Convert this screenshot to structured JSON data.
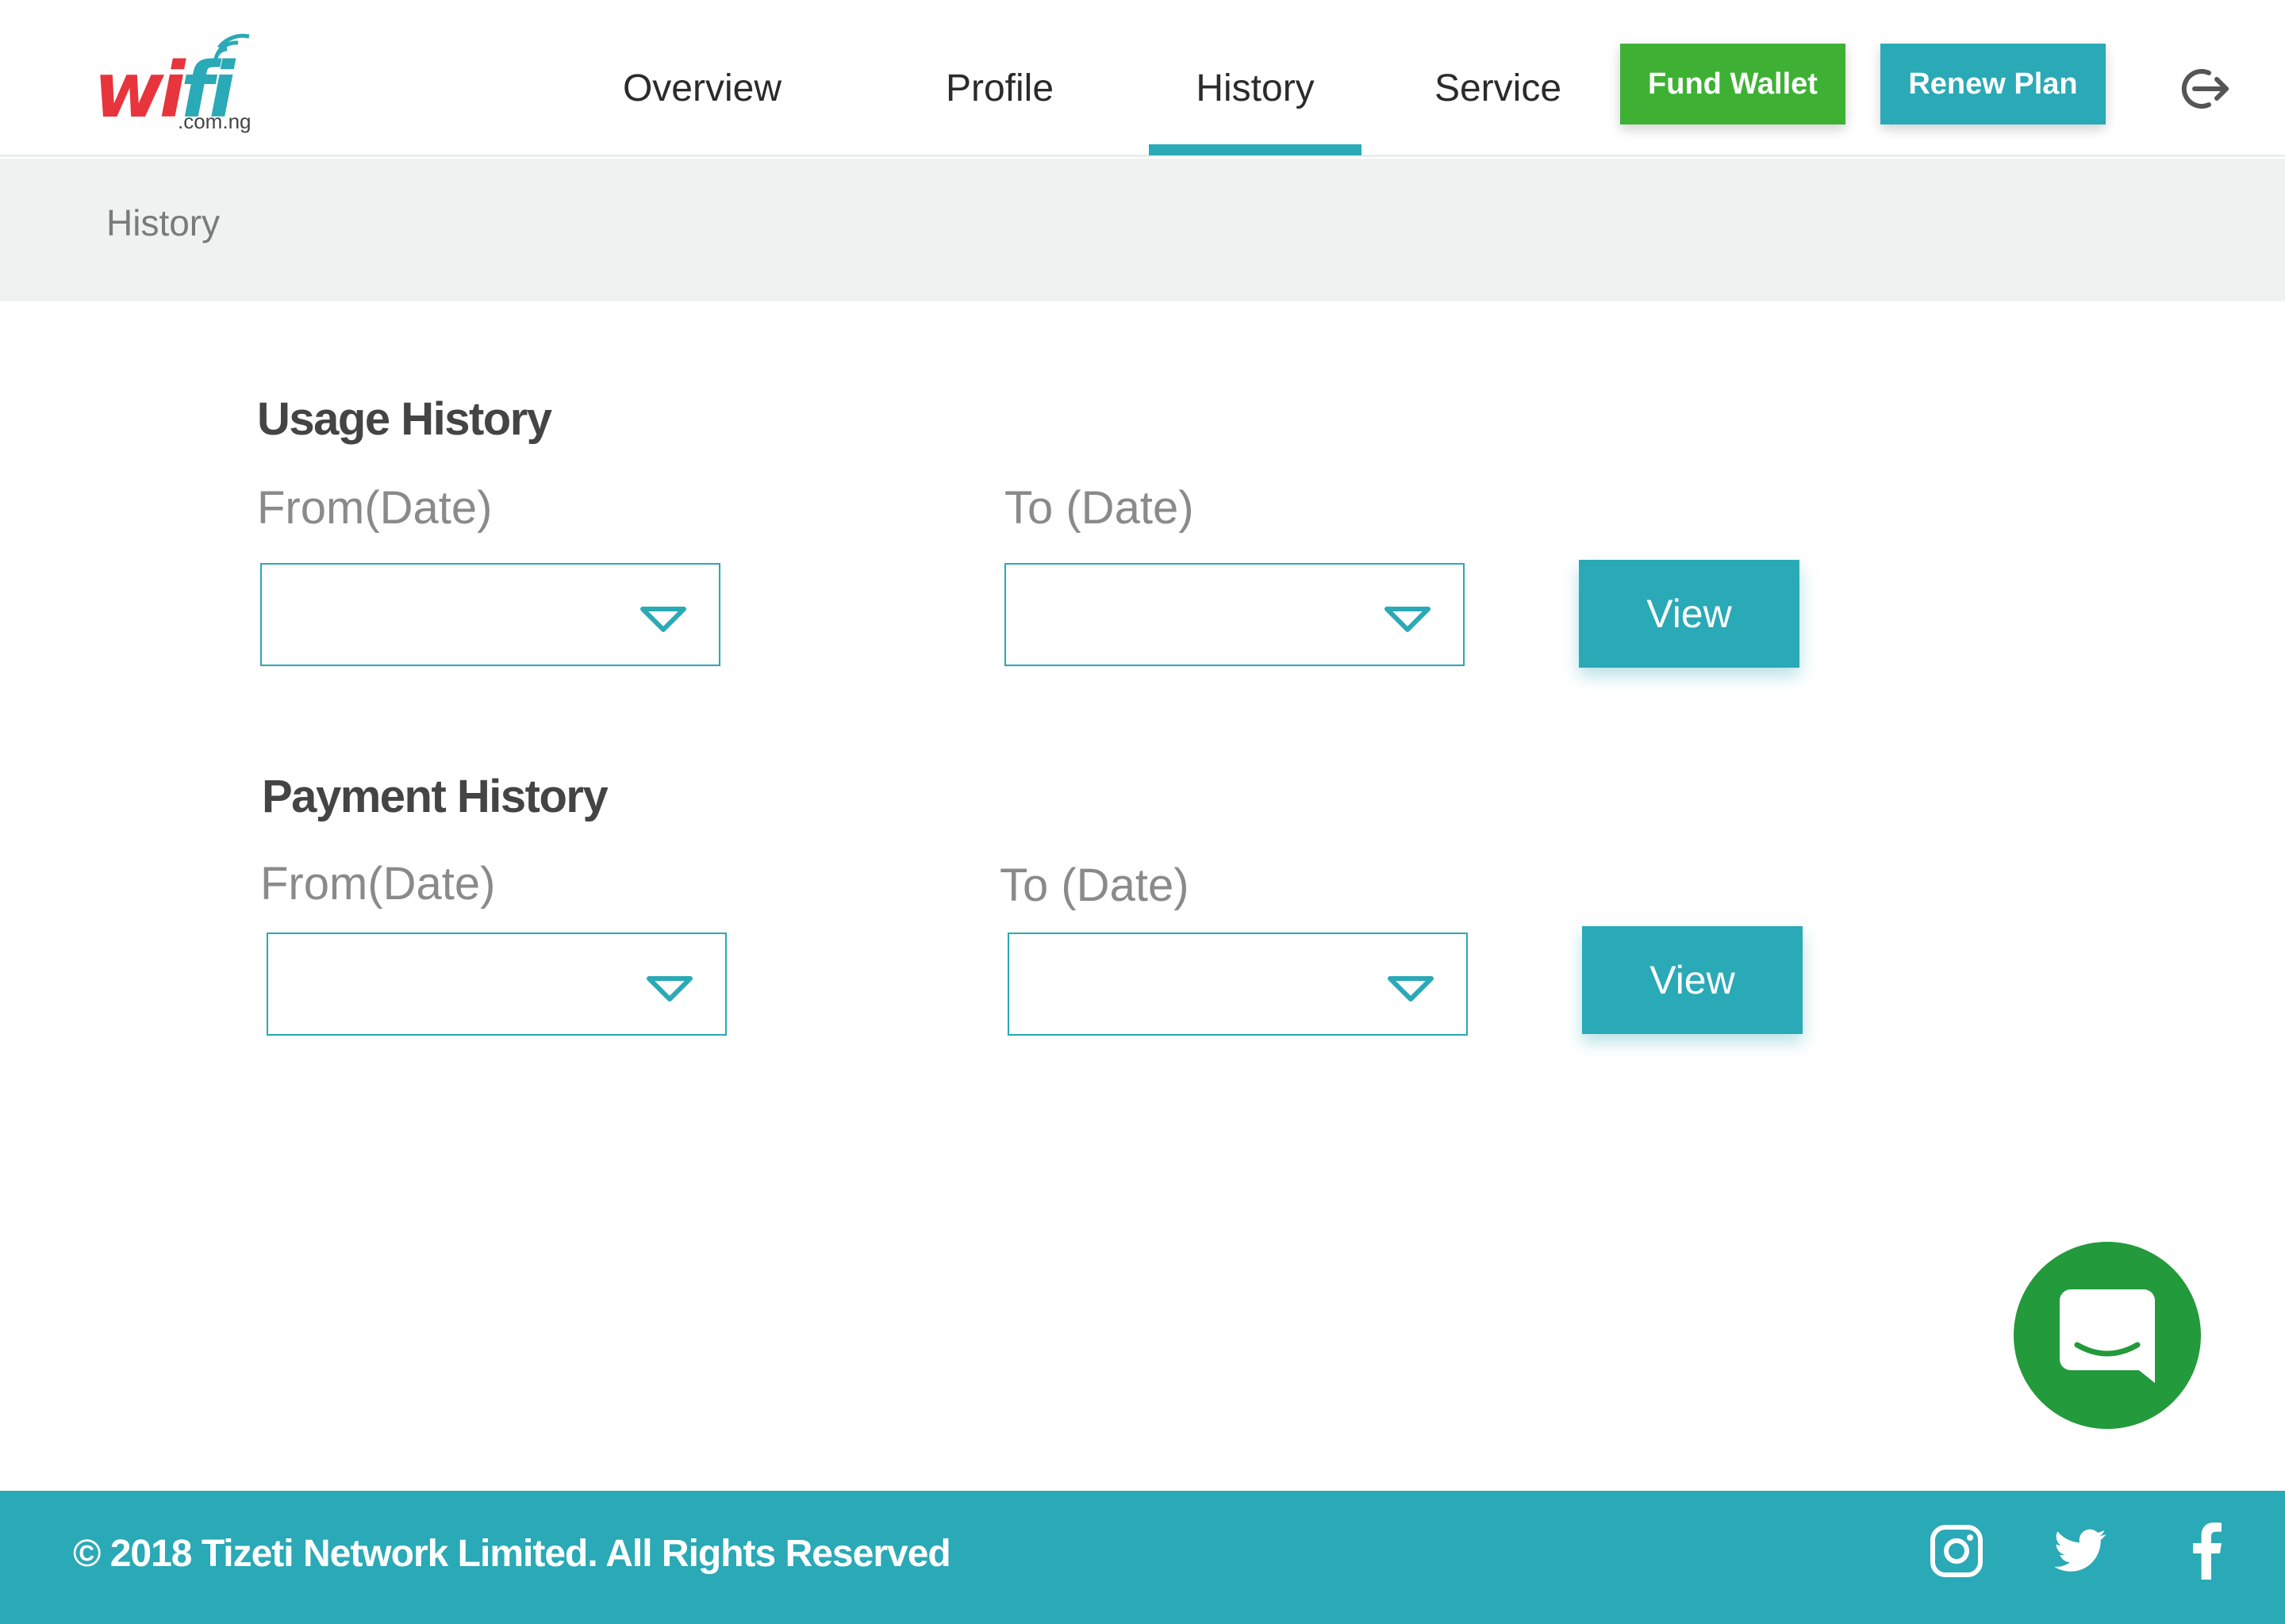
{
  "header": {
    "logo": {
      "word_a": "wi",
      "word_b": "fi",
      "suffix": ".com.ng"
    },
    "nav": [
      {
        "label": "Overview",
        "active": false
      },
      {
        "label": "Profile",
        "active": false
      },
      {
        "label": "History",
        "active": true
      },
      {
        "label": "Service",
        "active": false
      }
    ],
    "fund_wallet_label": "Fund Wallet",
    "renew_plan_label": "Renew Plan",
    "logout_icon": "logout-icon"
  },
  "breadcrumb": {
    "label": "History"
  },
  "usage_history": {
    "title": "Usage History",
    "from_label": "From(Date)",
    "to_label": "To (Date)",
    "from_value": "",
    "to_value": "",
    "view_label": "View"
  },
  "payment_history": {
    "title": "Payment History",
    "from_label": "From(Date)",
    "to_label": "To (Date)",
    "from_value": "",
    "to_value": "",
    "view_label": "View"
  },
  "footer": {
    "copyright": "© 2018 Tizeti Network Limited. All Rights Reserved",
    "social_icons": [
      "instagram-icon",
      "twitter-icon",
      "facebook-icon"
    ]
  },
  "chat": {
    "icon": "chat-icon"
  },
  "colors": {
    "primary": "#2aa9b6",
    "fund_wallet": "#3eb134",
    "chat": "#239a3b",
    "logo_red": "#e8343c"
  }
}
